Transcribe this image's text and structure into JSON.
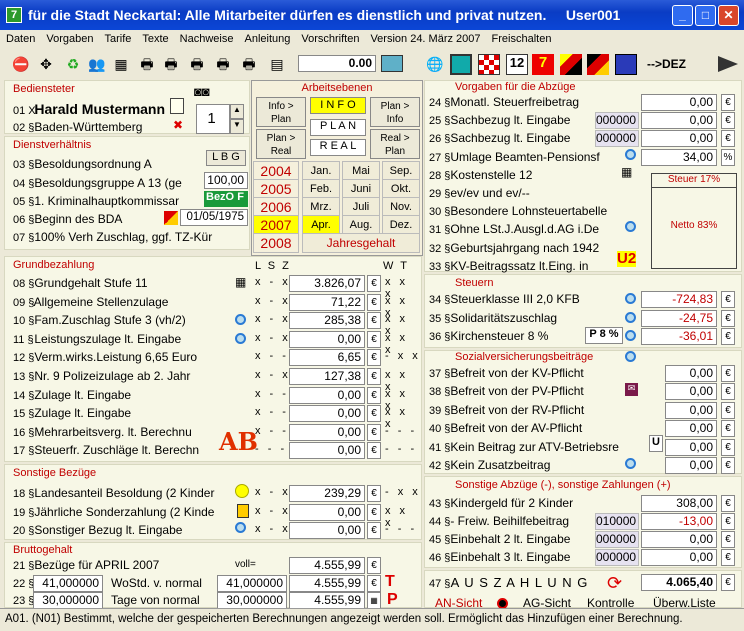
{
  "window": {
    "title": "für die Stadt Neckartal: Alle Mitarbeiter dürfen es dienstlich und privat nutzen.",
    "user": "User001",
    "icon_char": "7"
  },
  "menu": [
    "Daten",
    "Vorgaben",
    "Tarife",
    "Texte",
    "Nachweise",
    "Anleitung",
    "Vorschriften",
    "Version 24. März 2007",
    "Freischalten"
  ],
  "toolbar": {
    "amount": "0.00",
    "dez_label": "-->DEZ"
  },
  "bediensteter": {
    "heading": "Bediensteter",
    "name_num": "01 X",
    "name": "Harald Mustermann",
    "land_num": "02 §",
    "land": "Baden-Württemberg",
    "counter": "1"
  },
  "dienst": {
    "heading": "Dienstverhältnis",
    "lbg": "L B G",
    "pct": "100,00",
    "bezo": "BezO",
    "bezo_flag": "F",
    "date": "01/05/1975",
    "rows": [
      {
        "num": "03 §",
        "text": "Besoldungsordnung A"
      },
      {
        "num": "04 §",
        "text": "Besoldungsgruppe A 13 (ge"
      },
      {
        "num": "05 §",
        "text": "1. Kriminalhauptkommissar"
      },
      {
        "num": "06 §",
        "text": "Beginn des BDA"
      },
      {
        "num": "07 §",
        "text": "100% Verh Zuschlag, ggf. TZ-Kür"
      }
    ]
  },
  "arbeitsebenen": {
    "heading": "Arbeitsebenen",
    "info_plan": "Info > Plan",
    "info": "I N F O",
    "plan_info": "Plan > Info",
    "plan_real": "Plan > Real",
    "plan": "P L A N",
    "real_plan": "Real > Plan",
    "real": "R E A L",
    "years": [
      "2004",
      "2005",
      "2006",
      "2007",
      "2008"
    ],
    "months": [
      "Jan.",
      "Mai",
      "Sep.",
      "Feb.",
      "Juni",
      "Okt.",
      "Mrz.",
      "Juli",
      "Nov.",
      "Apr.",
      "Aug.",
      "Dez."
    ],
    "jahresgehalt": "Jahresgehalt"
  },
  "grund": {
    "heading": "Grundbezahlung",
    "cols": "L S Z",
    "wt": "W T",
    "rows": [
      {
        "num": "08 §",
        "text": "Grundgehalt Stufe 11",
        "v": "3.826,07",
        "lsz": "x - x",
        "wt": "x x x"
      },
      {
        "num": "09 §",
        "text": "Allgemeine Stellenzulage",
        "v": "71,22",
        "lsz": "x - x",
        "wt": "x x x"
      },
      {
        "num": "10 §",
        "text": "Fam.Zuschlag Stufe 3 (vh/2)",
        "v": "285,38",
        "lsz": "x - x",
        "wt": "x x x"
      },
      {
        "num": "11 §",
        "text": "Leistungszulage lt. Eingabe",
        "v": "0,00",
        "lsz": "x - x",
        "wt": "x x x"
      },
      {
        "num": "12 §",
        "text": "Verm.wirks.Leistung   6,65 Euro",
        "v": "6,65",
        "lsz": "x - -",
        "wt": "- x x"
      },
      {
        "num": "13 §",
        "text": "Nr. 9 Polizeizulage ab 2. Jahr",
        "v": "127,38",
        "lsz": "x - x",
        "wt": "x x x"
      },
      {
        "num": "14 §",
        "text": "Zulage lt. Eingabe",
        "v": "0,00",
        "lsz": "x - -",
        "wt": "x x x"
      },
      {
        "num": "15 §",
        "text": "Zulage lt. Eingabe",
        "v": "0,00",
        "lsz": "x - -",
        "wt": "x x x"
      },
      {
        "num": "16 §",
        "text": "Mehrarbeitsverg. lt. Berechnu",
        "v": "0,00",
        "lsz": "x - -",
        "wt": "- - -"
      },
      {
        "num": "17 §",
        "text": "Steuerfr. Zuschläge lt. Berechn",
        "v": "0,00",
        "lsz": "- - -",
        "wt": "- - -"
      }
    ]
  },
  "sonstige": {
    "heading": "Sonstige Bezüge",
    "rows": [
      {
        "num": "18 §",
        "text": "Landesanteil Besoldung (2 Kinder",
        "v": "239,29",
        "lsz": "x - x",
        "wt": "- x x"
      },
      {
        "num": "19 §",
        "text": "Jährliche Sonderzahlung (2 Kinde",
        "v": "0,00",
        "lsz": "x - x",
        "wt": "x x x"
      },
      {
        "num": "20 §",
        "text": "Sonstiger Bezug lt. Eingabe",
        "v": "0,00",
        "lsz": "x - x",
        "wt": "- - -"
      }
    ]
  },
  "brutto": {
    "heading": "Bruttogehalt",
    "num21": "21 §",
    "bezuege": "Bezüge für APRIL  2007",
    "voll": "voll=",
    "v21": "4.555,99",
    "num22": "22 §",
    "woStd": "41,000000",
    "woStd_lbl": "WoStd. v. normal",
    "woStd_ref": "41,000000",
    "v22": "4.555,99",
    "num23": "23 §",
    "tage": "30,000000",
    "tage_lbl": "Tage von normal",
    "tage_ref": "30,000000",
    "v23": "4.555,99"
  },
  "vorgaben": {
    "heading": "Vorgaben für die Abzüge",
    "rows": [
      {
        "num": "24 §",
        "text": "Monatl. Steuerfreibetrag",
        "v": "0,00",
        "u": "€"
      },
      {
        "num": "25 §",
        "text": "Sachbezug lt. Eingabe",
        "code": "000000",
        "v": "0,00",
        "u": "€"
      },
      {
        "num": "26 §",
        "text": "Sachbezug lt. Eingabe",
        "code": "000000",
        "v": "0,00",
        "u": "€"
      },
      {
        "num": "27 §",
        "text": "Umlage Beamten-Pensionsf",
        "v": "34,00",
        "u": "%"
      },
      {
        "num": "28 §",
        "text": "Kostenstelle 12"
      },
      {
        "num": "29 §",
        "text": "ev/ev und ev/--"
      },
      {
        "num": "30 §",
        "text": "Besondere Lohnsteuertabelle"
      },
      {
        "num": "31 §",
        "text": "Ohne LSt.J.Ausgl.d.AG i.De"
      },
      {
        "num": "32 §",
        "text": "Geburtsjahrgang nach 1942"
      },
      {
        "num": "33 §",
        "text": "KV-Beitragssatz lt.Eing. in"
      }
    ],
    "steuer_pct": "Steuer 17%",
    "netto_pct": "Netto  83%"
  },
  "steuern": {
    "heading": "Steuern",
    "rows": [
      {
        "num": "34 §",
        "text": "Steuerklasse III   2,0 KFB",
        "v": "-724,83"
      },
      {
        "num": "35 §",
        "text": "Solidaritätszuschlag",
        "v": "-24,75"
      },
      {
        "num": "36 §",
        "text": "Kirchensteuer 8 %",
        "v": "-36,01",
        "badge": "P 8 %"
      }
    ]
  },
  "sozial": {
    "heading": "Sozialversicherungsbeiträge",
    "rows": [
      {
        "num": "37 §",
        "text": "Befreit von der KV-Pflicht",
        "v": "0,00"
      },
      {
        "num": "38 §",
        "text": "Befreit von der PV-Pflicht",
        "v": "0,00"
      },
      {
        "num": "39 §",
        "text": "Befreit von der RV-Pflicht",
        "v": "0,00"
      },
      {
        "num": "40 §",
        "text": "Befreit von der AV-Pflicht",
        "v": "0,00"
      },
      {
        "num": "41 §",
        "text": "Kein Beitrag zur ATV-Betriebsre",
        "v": "0,00",
        "badge": "U"
      },
      {
        "num": "42 §",
        "text": "Kein Zusatzbeitrag",
        "v": "0,00"
      }
    ]
  },
  "abzuege": {
    "heading": "Sonstige Abzüge (-), sonstige Zahlungen (+)",
    "rows": [
      {
        "num": "43 §",
        "text": "Kindergeld für 2 Kinder",
        "v": "308,00"
      },
      {
        "num": "44 §",
        "text": "- Freiw. Beihilfebeitrag",
        "code": "010000",
        "v": "-13,00",
        "neg": true
      },
      {
        "num": "45 §",
        "text": "Einbehalt 2 lt. Eingabe",
        "code": "000000",
        "v": "0,00"
      },
      {
        "num": "46 §",
        "text": "Einbehalt 3 lt. Eingabe",
        "code": "000000",
        "v": "0,00"
      }
    ]
  },
  "auszahlung": {
    "num": "47 §",
    "label": "A U S Z A H L U N G",
    "v": "4.065,40",
    "an": "AN-Sicht",
    "ag": "AG-Sicht",
    "kontrolle": "Kontrolle",
    "uberw": "Überw.Liste"
  },
  "status": "A01. (N01) Bestimmt, welche der gespeicherten Berechnungen angezeigt werden soll. Ermöglicht das Hinzufügen einer Berechnung.",
  "currency": "€"
}
